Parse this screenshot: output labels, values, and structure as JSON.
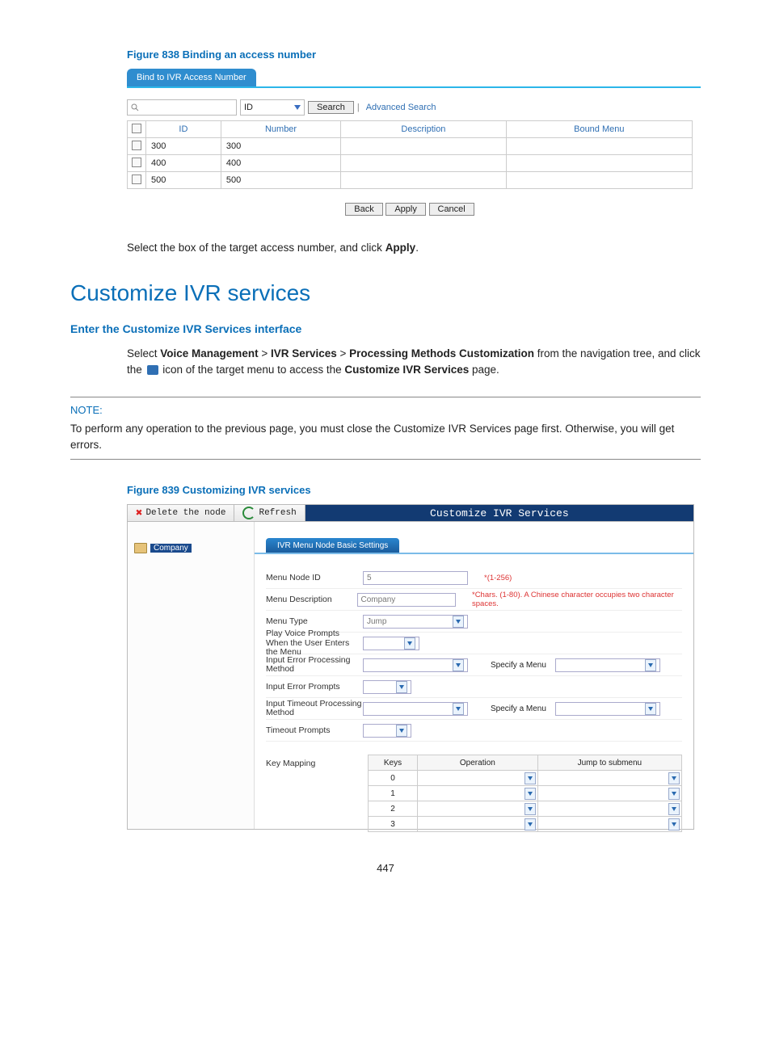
{
  "figure838": {
    "caption": "Figure 838 Binding an access number",
    "tab": "Bind to IVR Access Number",
    "search": {
      "field_select": "ID",
      "search_btn": "Search",
      "advanced": "Advanced Search"
    },
    "columns": [
      "ID",
      "Number",
      "Description",
      "Bound Menu"
    ],
    "rows": [
      {
        "id": "300",
        "number": "300",
        "description": "",
        "bound": ""
      },
      {
        "id": "400",
        "number": "400",
        "description": "",
        "bound": ""
      },
      {
        "id": "500",
        "number": "500",
        "description": "",
        "bound": ""
      }
    ],
    "buttons": {
      "back": "Back",
      "apply": "Apply",
      "cancel": "Cancel"
    },
    "instruction_pre": "Select the box of the target access number, and click ",
    "instruction_bold": "Apply",
    "instruction_post": "."
  },
  "section": {
    "title": "Customize IVR services",
    "subtitle": "Enter the Customize IVR Services interface",
    "nav_pre": "Select ",
    "nav_b1": "Voice Management",
    "nav_b2": "IVR Services",
    "nav_b3": "Processing Methods Customization",
    "nav_mid": " from the navigation tree, and click the ",
    "nav_post1": " icon of the target menu to access the ",
    "nav_b4": "Customize IVR Services",
    "nav_post2": " page."
  },
  "note": {
    "label": "NOTE:",
    "body": "To perform any operation to the previous page, you must close the Customize IVR Services page first. Otherwise, you will get errors."
  },
  "figure839": {
    "caption": "Figure 839 Customizing IVR services",
    "toolbar": {
      "delete": "Delete the node",
      "refresh": "Refresh"
    },
    "window_title": "Customize IVR Services",
    "tree_item": "Company",
    "panel_title": "IVR Menu Node Basic Settings",
    "fields": {
      "menu_node_id_lbl": "Menu Node ID",
      "menu_node_id_val": "5",
      "menu_node_id_hint": "*(1-256)",
      "menu_desc_lbl": "Menu Description",
      "menu_desc_val": "Company",
      "menu_desc_hint": "*Chars. (1-80). A Chinese character occupies two character spaces.",
      "menu_type_lbl": "Menu Type",
      "menu_type_val": "Jump",
      "play_prompts_lbl": "Play Voice Prompts When the User Enters the Menu",
      "input_err_lbl": "Input Error Processing Method",
      "specify_menu": "Specify a Menu",
      "input_err_prompts_lbl": "Input Error Prompts",
      "input_to_lbl": "Input Timeout Processing Method",
      "timeout_prompts_lbl": "Timeout Prompts",
      "key_mapping_lbl": "Key Mapping"
    },
    "key_table": {
      "headers": [
        "Keys",
        "Operation",
        "Jump to submenu"
      ],
      "keys": [
        "0",
        "1",
        "2",
        "3"
      ]
    }
  },
  "page_number": "447"
}
